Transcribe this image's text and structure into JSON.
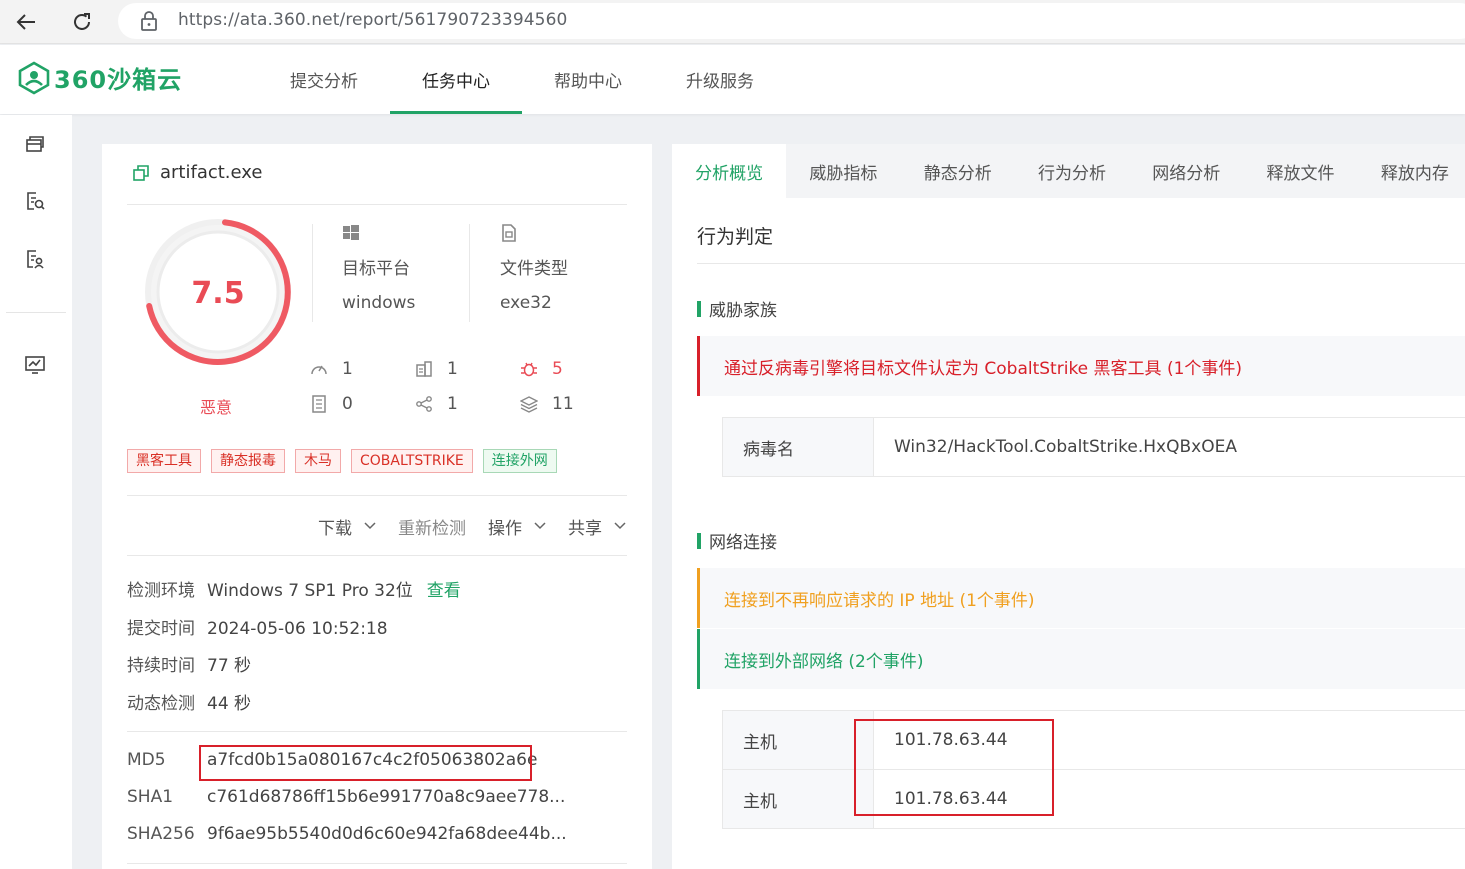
{
  "browser": {
    "url": "https://ata.360.net/report/561790723394560"
  },
  "brand": {
    "name": "360沙箱云",
    "color": "#21a366"
  },
  "nav": {
    "items": [
      {
        "label": "提交分析"
      },
      {
        "label": "任务中心"
      },
      {
        "label": "帮助中心"
      },
      {
        "label": "升级服务"
      }
    ]
  },
  "file": {
    "name": "artifact.exe",
    "score": "7.5",
    "verdict": "恶意",
    "platform_label": "目标平台",
    "platform_value": "windows",
    "type_label": "文件类型",
    "type_value": "exe32"
  },
  "stats": [
    {
      "icon": "gauge-icon",
      "value": "1"
    },
    {
      "icon": "building-icon",
      "value": "1"
    },
    {
      "icon": "bug-icon",
      "value": "5"
    },
    {
      "icon": "document-list-icon",
      "value": "0"
    },
    {
      "icon": "share-nodes-icon",
      "value": "1"
    },
    {
      "icon": "layers-icon",
      "value": "11"
    }
  ],
  "tags": [
    "黑客工具",
    "静态报毒",
    "木马",
    "COBALTSTRIKE",
    "连接外网"
  ],
  "actions": {
    "download": "下载",
    "recheck": "重新检测",
    "operate": "操作",
    "share": "共享"
  },
  "details": {
    "env_label": "检测环境",
    "env_value": "Windows 7 SP1 Pro 32位",
    "env_link": "查看",
    "submit_label": "提交时间",
    "submit_value": "2024-05-06 10:52:18",
    "duration_label": "持续时间",
    "duration_value": "77 秒",
    "dynamic_label": "动态检测",
    "dynamic_value": "44 秒"
  },
  "hashes": {
    "md5_label": "MD5",
    "md5_value": "a7fcd0b15a080167c4c2f05063802a6e",
    "sha1_label": "SHA1",
    "sha1_value": "c761d68786ff15b6e991770a8c9aee778...",
    "sha256_label": "SHA256",
    "sha256_value": "9f6ae95b5540d0d6c60e942fa68dee44b..."
  },
  "report_tabs": [
    "分析概览",
    "威胁指标",
    "静态分析",
    "行为分析",
    "网络分析",
    "释放文件",
    "释放内存"
  ],
  "report": {
    "section_title": "行为判定",
    "threat_family_title": "威胁家族",
    "threat_event": "通过反病毒引擎将目标文件认定为 CobaltStrike 黑客工具 (1个事件)",
    "virus_name_label": "病毒名",
    "virus_name_value": "Win32/HackTool.CobaltStrike.HxQBxOEA",
    "network_title": "网络连接",
    "network_event_1": "连接到不再响应请求的 IP 地址 (1个事件)",
    "network_event_2": "连接到外部网络 (2个事件)",
    "host_label": "主机",
    "hosts": [
      "101.78.63.44",
      "101.78.63.44"
    ]
  }
}
